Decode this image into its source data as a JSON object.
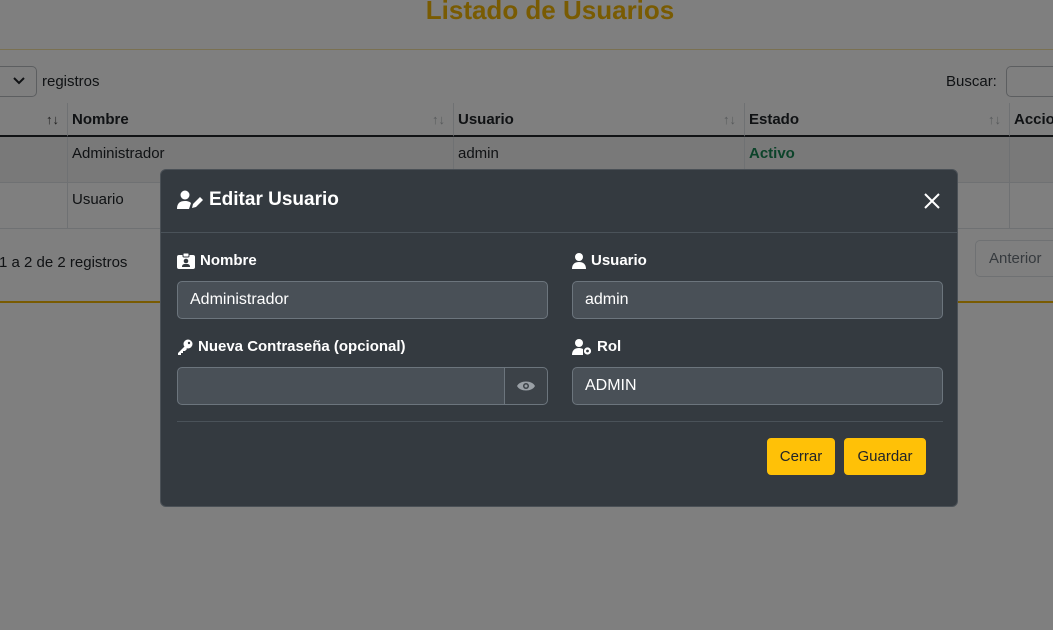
{
  "page": {
    "title": "Listado de Usuarios"
  },
  "table_controls": {
    "length_suffix": "registros",
    "search_label": "Buscar:"
  },
  "table": {
    "headers": [
      "Nombre",
      "Usuario",
      "Estado",
      "Accio"
    ],
    "rows": [
      {
        "nombre": "Administrador",
        "usuario": "admin",
        "estado": "Activo"
      },
      {
        "nombre": "Usuario",
        "usuario": "",
        "estado": ""
      }
    ],
    "info": "1 a 2 de 2 registros",
    "prev_label": "Anterior"
  },
  "modal": {
    "title": "Editar Usuario",
    "fields": {
      "nombre": {
        "label": "Nombre",
        "value": "Administrador"
      },
      "usuario": {
        "label": "Usuario",
        "value": "admin"
      },
      "password": {
        "label": "Nueva Contraseña (opcional)",
        "value": ""
      },
      "rol": {
        "label": "Rol",
        "value": "ADMIN"
      }
    },
    "buttons": {
      "close": "Cerrar",
      "save": "Guardar"
    }
  },
  "colors": {
    "accent": "#ffc107",
    "title": "#f2b705",
    "modal_bg": "#343a40",
    "status_active": "#198754"
  },
  "icons": {
    "title": "user-edit-icon",
    "nombre": "id-badge-icon",
    "usuario": "user-icon",
    "password": "key-icon",
    "rol": "user-cog-icon",
    "toggle": "eye-icon",
    "close": "close-icon"
  }
}
